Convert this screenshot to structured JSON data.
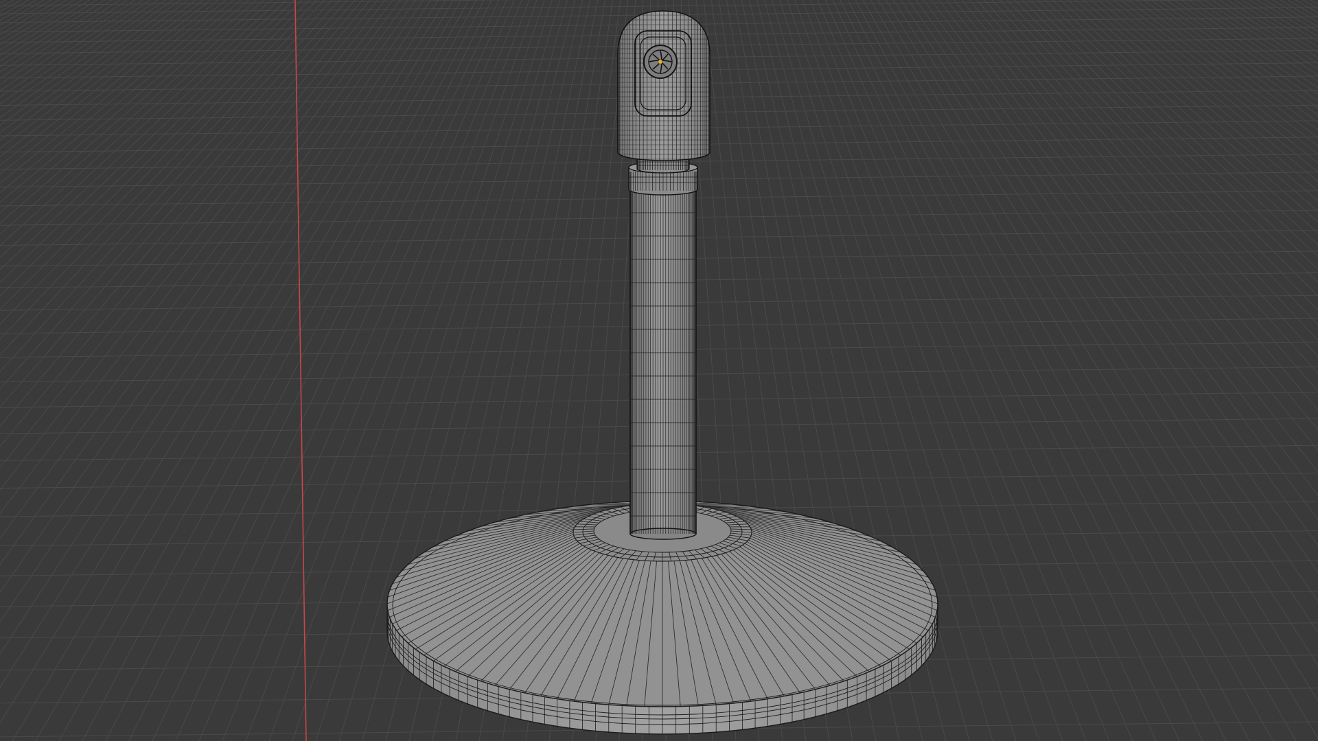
{
  "viewport": {
    "mode": "3d-viewport-wireframe-overlay",
    "background_color": "#3a3a3a",
    "grid_color": "#4a4a4a",
    "x_axis_color": "#c8464b",
    "mesh_fill_color": "#8f8f8f",
    "mesh_shadow_color": "#6a6a6a",
    "wire_color": "#1c1c1c",
    "selected_vertex_color": "#e0b040"
  },
  "object": {
    "name_icon": "mesh-object",
    "parts": [
      "microphone-head",
      "collar",
      "stem",
      "base-plate"
    ]
  }
}
